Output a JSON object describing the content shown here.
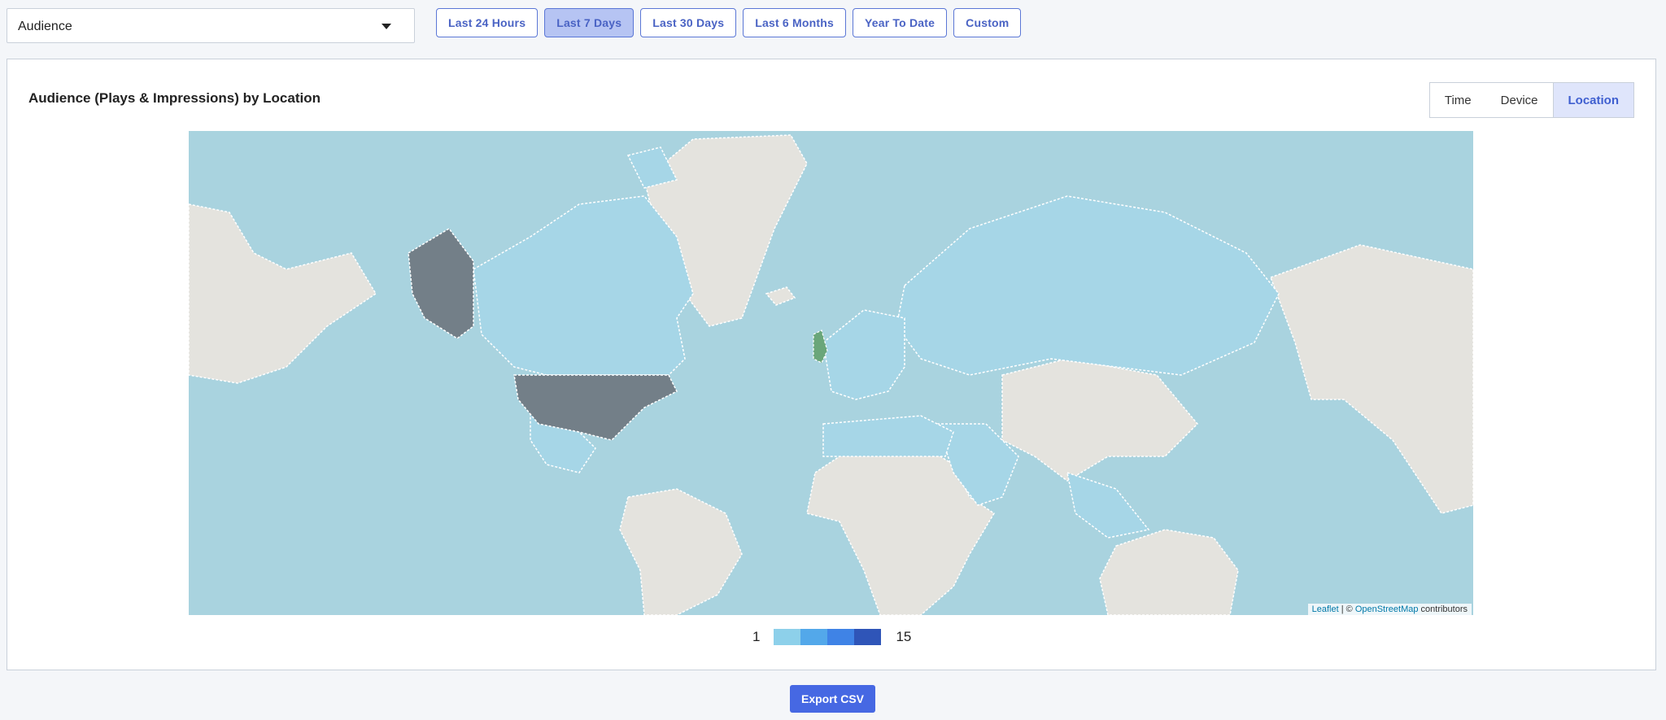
{
  "metric_select": {
    "value": "Audience",
    "icon": "chevron-down-icon"
  },
  "ranges": [
    {
      "label": "Last 24 Hours",
      "active": false
    },
    {
      "label": "Last 7 Days",
      "active": true
    },
    {
      "label": "Last 30 Days",
      "active": false
    },
    {
      "label": "Last 6 Months",
      "active": false
    },
    {
      "label": "Year To Date",
      "active": false
    },
    {
      "label": "Custom",
      "active": false
    }
  ],
  "panel": {
    "title": "Audience (Plays & Impressions) by Location",
    "views": [
      {
        "label": "Time",
        "active": false
      },
      {
        "label": "Device",
        "active": false
      },
      {
        "label": "Location",
        "active": true
      }
    ]
  },
  "map": {
    "attribution_leaflet": "Leaflet",
    "attribution_sep": " | © ",
    "attribution_osm": "OpenStreetMap",
    "attribution_tail": " contributors",
    "colors": {
      "ocean": "#a9d3df",
      "land_nodata": "#e4e3de",
      "low": "#a6d6e7",
      "high": "#737f88",
      "highlight": "#6aa67a"
    }
  },
  "legend": {
    "min": "1",
    "max": "15",
    "swatches": [
      "#8dd0ea",
      "#53a8ea",
      "#3f83e6",
      "#2f55b8"
    ]
  },
  "export_label": "Export CSV"
}
